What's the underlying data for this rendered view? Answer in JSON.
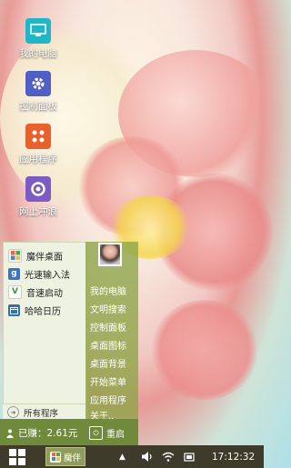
{
  "desktop": {
    "icons": [
      {
        "label": "我的电脑",
        "icon": "computer-icon",
        "color": "#1fb6c8"
      },
      {
        "label": "控制面板",
        "icon": "gear-icon",
        "color": "#4f5fc4"
      },
      {
        "label": "应用程序",
        "icon": "apps-icon",
        "color": "#e8602c"
      },
      {
        "label": "网上冲浪",
        "icon": "browser-icon",
        "color": "#7c5cc4"
      }
    ]
  },
  "start_menu": {
    "items": [
      {
        "label": "魔伴桌面",
        "icon": "magic-desktop-icon"
      },
      {
        "label": "光速输入法",
        "icon": "input-method-icon"
      },
      {
        "label": "音速启动",
        "icon": "quick-launch-icon"
      },
      {
        "label": "哈哈日历",
        "icon": "calendar-icon"
      }
    ],
    "all_programs": "所有程序",
    "right_items": [
      "我的电脑",
      "文明搜索",
      "控制面板",
      "桌面图标",
      "桌面背景",
      "开始菜单",
      "应用程序",
      "关于.."
    ],
    "earned": "已赚：2.61元",
    "restart": "重启"
  },
  "taskbar": {
    "app_label": "魔伴",
    "time": "17:12:32"
  },
  "colors": {
    "menu_accent": "#8ca546",
    "taskbar": "#3e3b2a"
  }
}
